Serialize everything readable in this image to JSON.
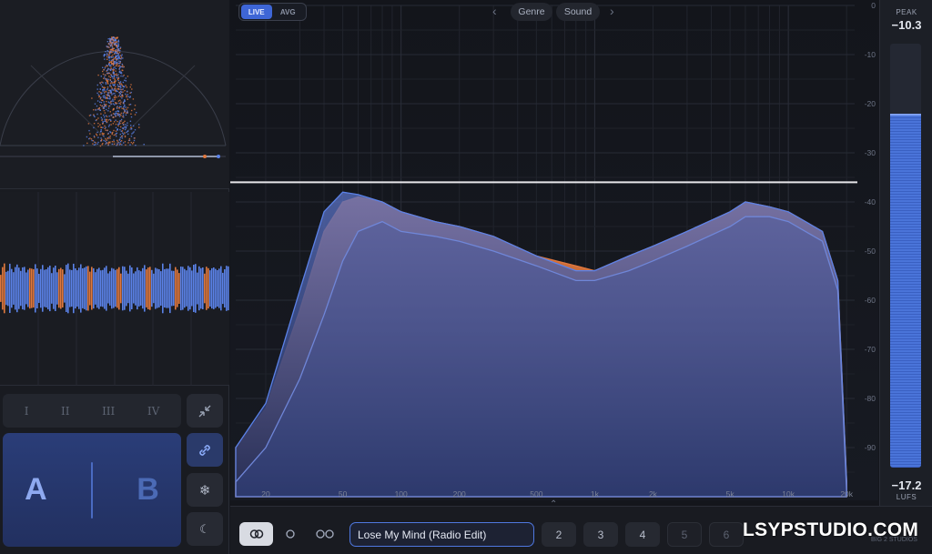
{
  "colors": {
    "live": "#3e66d6",
    "blue_series": "#5b82e8",
    "orange_series": "#e0783e",
    "accent": "#4f78e0"
  },
  "left_panel": {
    "bands": [
      "I",
      "II",
      "III",
      "IV"
    ],
    "ab": {
      "a": "A",
      "b": "B"
    }
  },
  "spectrum": {
    "view_toggle": {
      "live": "LIVE",
      "avg": "AVG",
      "selected": "LIVE"
    },
    "tabs": [
      "Genre",
      "Sound"
    ],
    "db_labels": [
      "0",
      "-10",
      "-20",
      "-30",
      "-40",
      "-50",
      "-60",
      "-70",
      "-80",
      "-90"
    ],
    "freq_labels": [
      "20",
      "50",
      "100",
      "200",
      "500",
      "1k",
      "2k",
      "5k",
      "10k",
      "20k"
    ],
    "reference_db": -36
  },
  "meter": {
    "peak_label": "PEAK",
    "peak_value": "−10.3",
    "lufs_value": "−17.2",
    "lufs_label": "LUFS",
    "level_fraction": 0.83
  },
  "bottom": {
    "preset_name": "Lose My Mind (Radio Edit)",
    "slots": [
      "2",
      "3",
      "4",
      "5",
      "6"
    ],
    "watermark": "LSYPSTUDIO.COM",
    "watermark_sub": "BIG 2 STUDIOS"
  },
  "chart_data": {
    "type": "area",
    "xlabel": "",
    "ylabel": "",
    "x_scale": "log",
    "xlim": [
      14,
      22000
    ],
    "ylim": [
      -100,
      0
    ],
    "x": [
      14,
      20,
      30,
      40,
      50,
      60,
      80,
      100,
      150,
      200,
      300,
      500,
      800,
      1000,
      1500,
      2000,
      3000,
      5000,
      6000,
      8000,
      10000,
      15000,
      18000,
      20000
    ],
    "series": [
      {
        "values": [
          -90,
          -82,
          -62,
          -46,
          -40,
          -39,
          -40,
          -42,
          -44,
          -45,
          -47,
          -51,
          -53,
          -54,
          -51,
          -49,
          -46,
          -42,
          -40,
          -41,
          -42,
          -46,
          -56,
          -97
        ]
      },
      {
        "values": [
          -90,
          -81,
          -58,
          -42,
          -38,
          -38.5,
          -40,
          -42,
          -44,
          -45,
          -47,
          -51,
          -54,
          -54,
          -51,
          -49,
          -46,
          -42,
          -40,
          -41,
          -42,
          -46,
          -56,
          -97
        ]
      },
      {
        "values": [
          -97,
          -90,
          -76,
          -63,
          -52,
          -46,
          -44,
          -46,
          -47,
          -48,
          -50,
          -53,
          -56,
          -56,
          -54,
          -52,
          -49,
          -45,
          -43,
          -43,
          -44,
          -48,
          -58,
          -99
        ]
      }
    ]
  }
}
